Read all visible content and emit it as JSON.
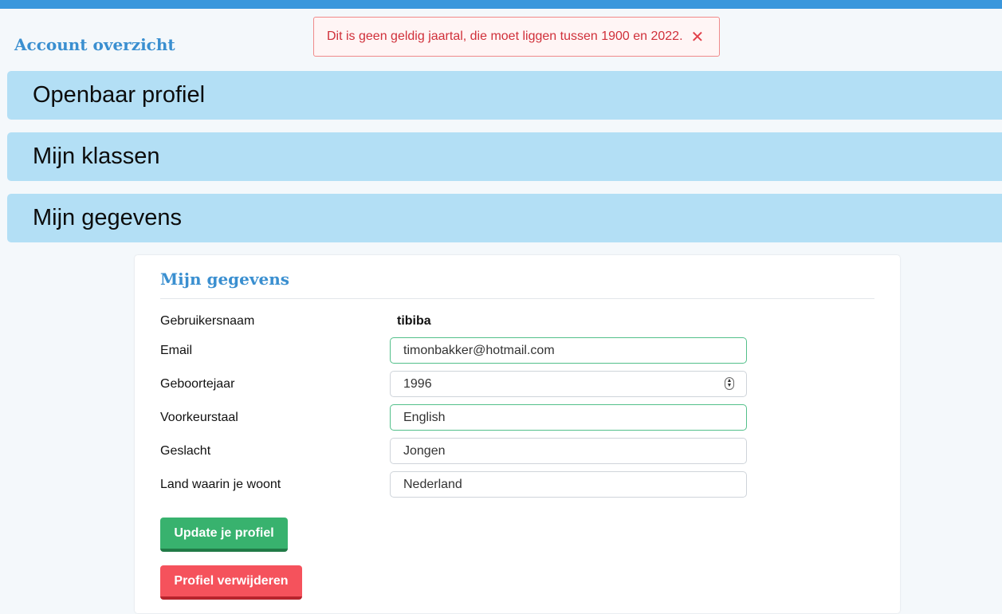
{
  "alert": {
    "message": "Dit is geen geldig jaartal, die moet liggen tussen 1900 en 2022.",
    "close_symbol": "✕"
  },
  "page": {
    "title": "Account overzicht"
  },
  "accordion": [
    {
      "label": "Openbaar profiel"
    },
    {
      "label": "Mijn klassen"
    },
    {
      "label": "Mijn gegevens"
    }
  ],
  "card": {
    "title": "Mijn gegevens",
    "rows": [
      {
        "label": "Gebruikersnaam",
        "value": "tibiba"
      },
      {
        "label": "Email",
        "value": "timonbakker@hotmail.com"
      },
      {
        "label": "Geboortejaar",
        "value": "1996"
      },
      {
        "label": "Voorkeurstaal",
        "value": "English"
      },
      {
        "label": "Geslacht",
        "value": "Jongen"
      },
      {
        "label": "Land waarin je woont",
        "value": "Nederland"
      }
    ],
    "update_button": "Update je profiel",
    "delete_button": "Profiel verwijderen"
  },
  "colors": {
    "accent": "#3a97dc",
    "accordion_bg": "#b3dff5",
    "alert_text": "#d0303a",
    "success": "#38b26e",
    "danger": "#f5525c"
  }
}
